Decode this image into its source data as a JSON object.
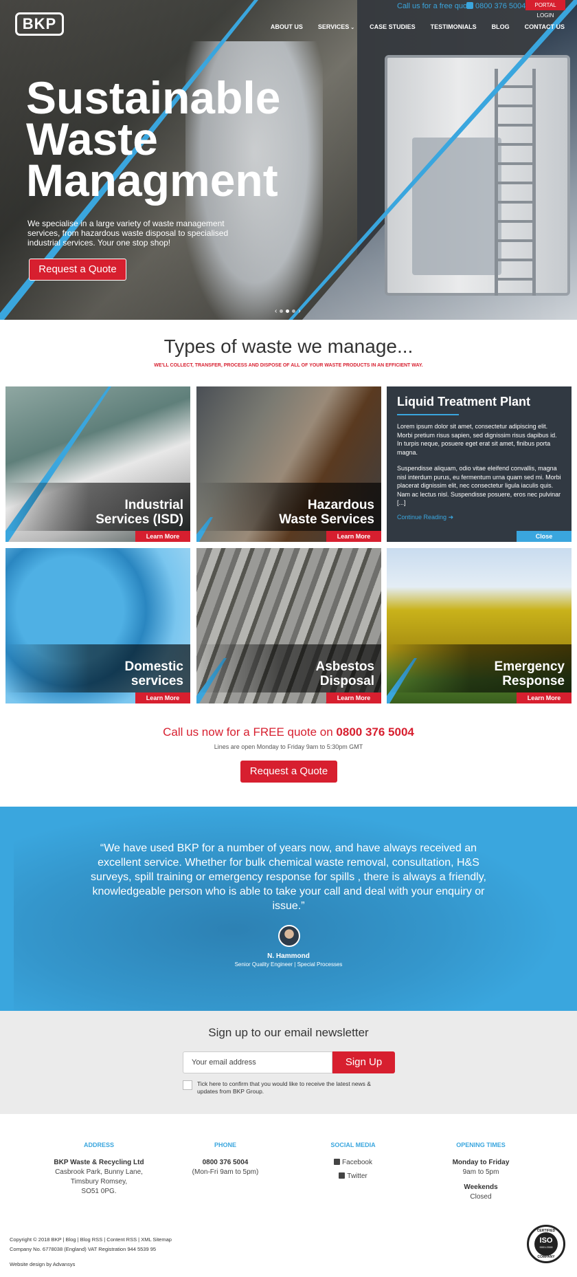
{
  "header": {
    "logo_text": "BKP",
    "call_text": "Call us for a free quote",
    "phone": "0800 376 5004",
    "portal_login": "PORTAL LOGIN",
    "nav": [
      "ABOUT US",
      "SERVICES",
      "CASE STUDIES",
      "TESTIMONIALS",
      "BLOG",
      "CONTACT US"
    ]
  },
  "hero": {
    "title_lines": [
      "Sustainable",
      "Waste",
      "Managment"
    ],
    "subtitle": "We specialise in a large variety of waste management services, from hazardous waste disposal to specialised industrial services. Your one stop shop!",
    "cta": "Request a Quote",
    "slider_prev": "‹",
    "slider_next": "›"
  },
  "types": {
    "title": "Types of waste we manage...",
    "subtitle": "WE'LL COLLECT, TRANSFER, PROCESS AND DISPOSE OF ALL OF YOUR WASTE PRODUCTS IN AN EFFICIENT WAY.",
    "learn_more": "Learn More",
    "tiles": [
      {
        "line1": "Industrial",
        "line2": "Services (ISD)"
      },
      {
        "line1": "Hazardous",
        "line2": "Waste Services"
      },
      {
        "line1": "Domestic",
        "line2": "services"
      },
      {
        "line1": "Asbestos",
        "line2": "Disposal"
      },
      {
        "line1": "Emergency",
        "line2": "Response"
      }
    ],
    "info": {
      "title": "Liquid Treatment Plant",
      "p1": "Lorem ipsum dolor sit amet, consectetur adipiscing elit. Morbi pretium risus sapien, sed dignissim risus dapibus id. In turpis neque, posuere eget erat sit amet, finibus porta magna.",
      "p2": "Suspendisse aliquam, odio vitae eleifend convallis, magna nisl interdum purus, eu fermentum urna quam sed mi. Morbi placerat dignissim elit, nec consectetur ligula iaculis quis. Nam ac lectus nisl. Suspendisse posuere, eros nec pulvinar [...]",
      "link": "Continue Reading",
      "close": "Close"
    }
  },
  "call": {
    "text": "Call us now for a FREE quote on",
    "phone": "0800 376 5004",
    "hours": "Lines are open Monday to Friday 9am to 5:30pm GMT",
    "cta": "Request a Quote"
  },
  "testimonial": {
    "quote": "“We have used BKP for a number of years now, and have always received an excellent service. Whether for bulk chemical waste removal, consultation, H&S surveys, spill training or emergency response for spills , there is always a friendly, knowledgeable person who is able to take your call and deal with your enquiry or issue.”",
    "name": "N. Hammond",
    "role": "Senior Quality Engineer  |  Special Processes"
  },
  "newsletter": {
    "title": "Sign up to our email newsletter",
    "placeholder": "Your email address",
    "button": "Sign Up",
    "consent": "Tick here to confirm that you would like to receive the latest news & updates from BKP Group."
  },
  "footer": {
    "address": {
      "heading": "ADDRESS",
      "company": "BKP Waste & Recycling Ltd",
      "line1": "Casbrook Park, Bunny Lane,",
      "line2": "Timsbury Romsey,",
      "line3": "SO51 0PG."
    },
    "phone": {
      "heading": "PHONE",
      "number": "0800 376 5004",
      "hours": "(Mon-Fri 9am to 5pm)"
    },
    "social": {
      "heading": "SOCIAL MEDIA",
      "facebook": "Facebook",
      "twitter": "Twitter"
    },
    "opening": {
      "heading": "OPENING TIMES",
      "weekday_label": "Monday to Friday",
      "weekday_hours": "9am to 5pm",
      "weekend_label": "Weekends",
      "weekend_hours": "Closed"
    },
    "copyright": "Copyright © 2018 BKP | Blog | Blog RSS | Content RSS | XML Sitemap",
    "company_no": "Company No. 6778038 (England)  VAT Registration 944 5539 95",
    "design": "Website design by Advansys",
    "iso_top": "CERTIFIED",
    "iso_main": "ISO",
    "iso_std": "9001:2008",
    "iso_bottom": "COMPANY"
  },
  "colors": {
    "brand_red": "#d71f2f",
    "brand_blue": "#3aa6de"
  }
}
